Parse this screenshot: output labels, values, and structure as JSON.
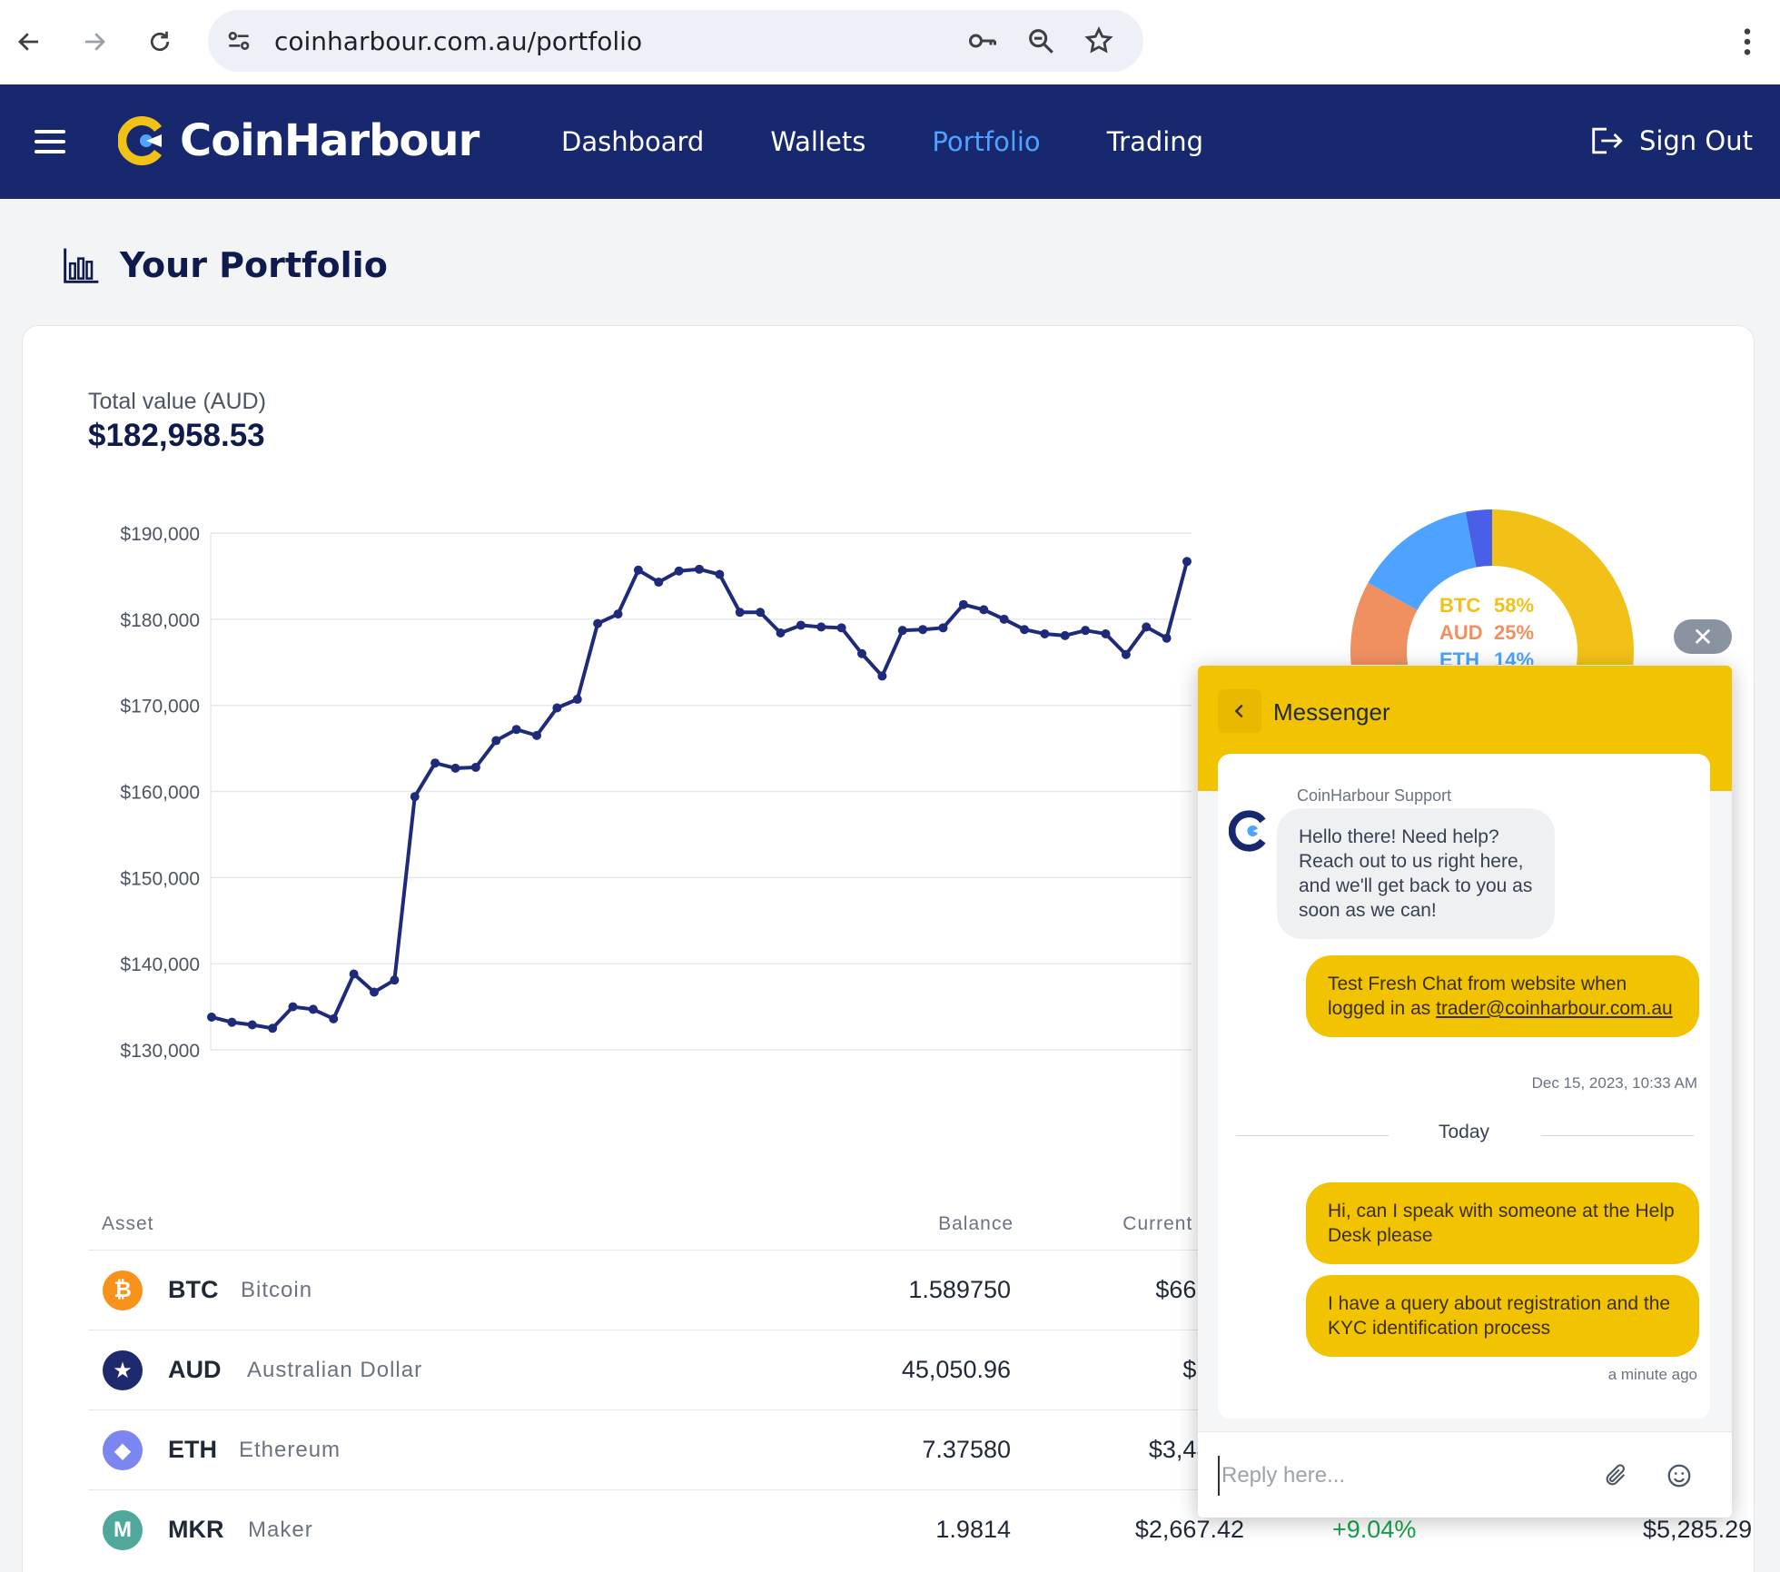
{
  "browser": {
    "url": "coinharbour.com.au/portfolio"
  },
  "header": {
    "brand": "CoinHarbour",
    "nav": [
      "Dashboard",
      "Wallets",
      "Portfolio",
      "Trading"
    ],
    "active_nav": "Portfolio",
    "sign_out": "Sign Out",
    "bg_color": "#17286f",
    "accent_color": "#4da3ff"
  },
  "page": {
    "title": "Your Portfolio",
    "total_label": "Total value (AUD)",
    "total_value": "$182,958.53"
  },
  "chart_data": [
    {
      "type": "line",
      "title": "",
      "xlabel": "",
      "ylabel": "",
      "ylim": [
        130000,
        190000
      ],
      "yticks": [
        "$190,000",
        "$180,000",
        "$170,000",
        "$160,000",
        "$150,000",
        "$140,000",
        "$130,000"
      ],
      "ytick_values": [
        190000,
        180000,
        170000,
        160000,
        150000,
        140000,
        130000
      ],
      "grid": true,
      "color": "#1e2a7a",
      "series": [
        {
          "values": [
            133800,
            133200,
            132900,
            132500,
            135000,
            134700,
            133600,
            138800,
            136700,
            138100,
            159400,
            163300,
            162700,
            162800,
            165900,
            167200,
            166500,
            169700,
            170700,
            179500,
            180600,
            185700,
            184300,
            185600,
            185800,
            185200,
            180800,
            180800,
            178400,
            179300,
            179100,
            179000,
            176000,
            173400,
            178700,
            178800,
            179000,
            181700,
            181100,
            180000,
            178800,
            178300,
            178100,
            178700,
            178300,
            175900,
            179100,
            177800,
            186700
          ]
        }
      ]
    },
    {
      "type": "pie",
      "labels": [
        "BTC",
        "AUD",
        "ETH",
        "MKR"
      ],
      "values": [
        58,
        25,
        14,
        3
      ],
      "display": [
        "58%",
        "25%",
        "14%",
        ""
      ],
      "colors": [
        "#f2c118",
        "#f09060",
        "#4da3ff",
        "#4a5fe8"
      ]
    }
  ],
  "table": {
    "headers": {
      "asset": "Asset",
      "balance": "Balance",
      "price": "Current Price"
    },
    "rows": [
      {
        "symbol": "BTC",
        "name": "Bitcoin",
        "balance": "1.589750",
        "price": "$66,329",
        "change": "",
        "value": "",
        "icon": "bitcoin-icon",
        "color": "#f7931a",
        "glyph": "₿"
      },
      {
        "symbol": "AUD",
        "name": "Australian Dollar",
        "balance": "45,050.96",
        "price": "$1.00",
        "change": "",
        "value": "",
        "icon": "australia-flag-icon",
        "color": "#1e2a6e",
        "glyph": "★"
      },
      {
        "symbol": "ETH",
        "name": "Ethereum",
        "balance": "7.37580",
        "price": "$3,486.9",
        "change": "",
        "value": "",
        "icon": "ethereum-icon",
        "color": "#7b86f0",
        "glyph": "◆"
      },
      {
        "symbol": "MKR",
        "name": "Maker",
        "balance": "1.9814",
        "price": "$2,667.42",
        "change": "+9.04%",
        "value": "$5,285.29",
        "icon": "maker-icon",
        "color": "#4fa89b",
        "glyph": "M"
      }
    ]
  },
  "messenger": {
    "title": "Messenger",
    "sender": "CoinHarbour Support",
    "agent_message": "Hello there! Need help? Reach out to us right here, and we'll get back to you as soon as we can!",
    "user_message_1_text": "Test Fresh Chat from website when logged in as",
    "user_message_1_link": "trader@coinharbour.com.au",
    "timestamp_1": "Dec 15, 2023, 10:33 AM",
    "day_separator": "Today",
    "user_message_2": "Hi, can I speak with someone at the Help Desk please",
    "user_message_3": "I have a query about registration and the KYC identification process",
    "timestamp_2": "a minute ago",
    "reply_placeholder": "Reply here...",
    "color": "#f2c300"
  }
}
